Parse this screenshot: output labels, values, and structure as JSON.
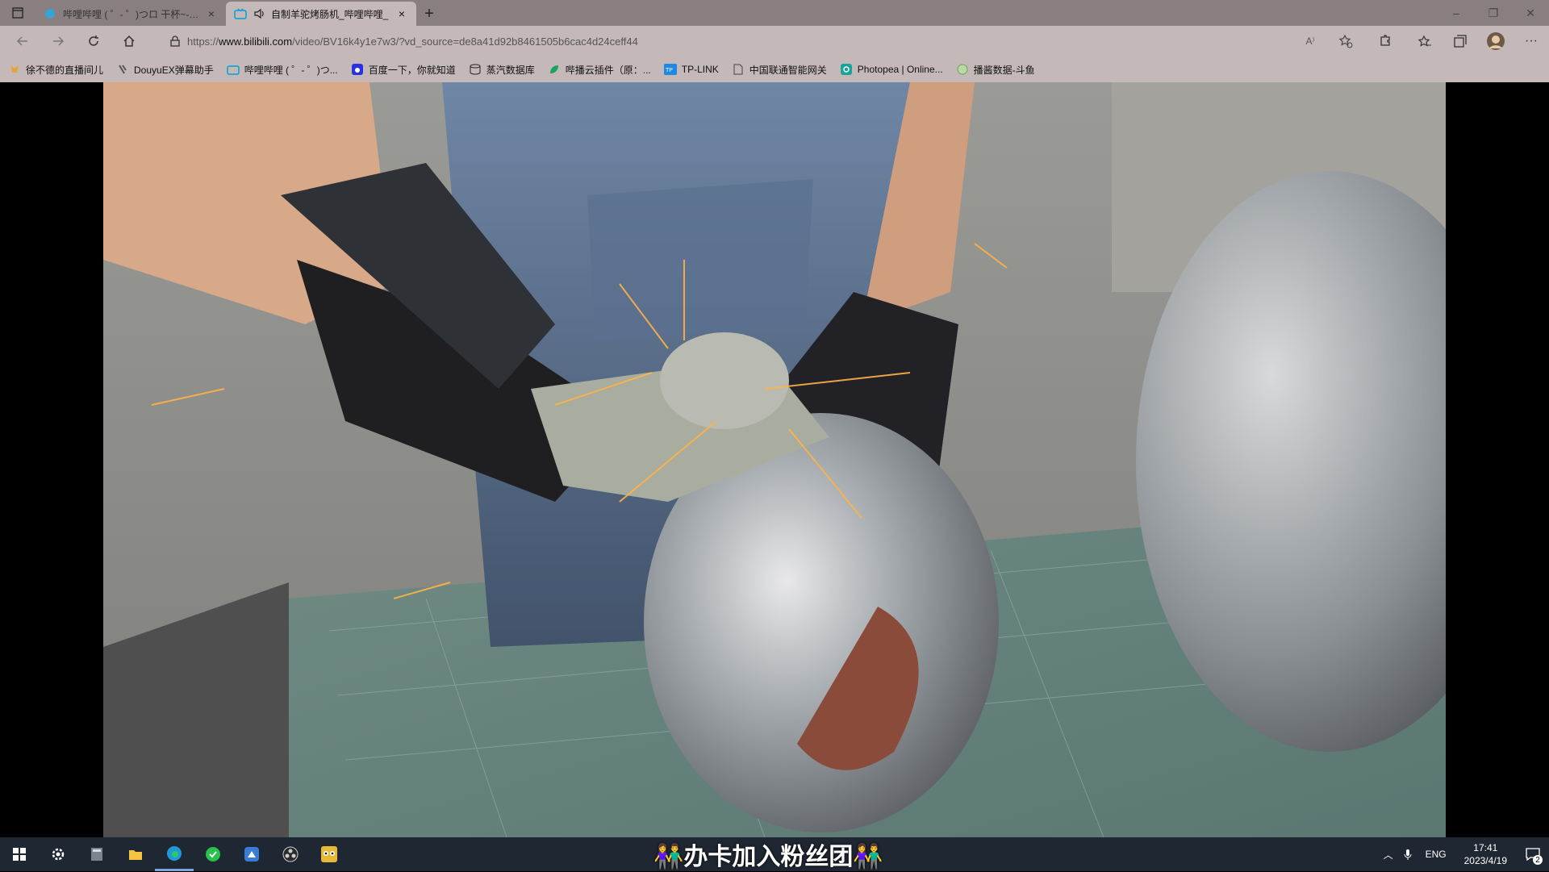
{
  "browser": {
    "tabs": [
      {
        "title": "哔哩哔哩 ( ゜- ゜)つロ 干杯~-bili",
        "active": false
      },
      {
        "title": "自制羊驼烤肠机_哔哩哔哩_",
        "active": true
      }
    ],
    "new_tab_label": "+",
    "url_prefix": "https://",
    "url_domain": "www.bilibili.com",
    "url_path": "/video/BV16k4y1e7w3/?vd_source=de8a41d92b8461505b6cac4d24ceff44",
    "read_aloud_label": "A⁾"
  },
  "bookmarks": [
    {
      "label": "徐不德的直播间儿",
      "icon": "fox-icon",
      "color": "#e6a23c"
    },
    {
      "label": "DouyuEX弹幕助手",
      "icon": "tv-icon",
      "color": "#666666"
    },
    {
      "label": "哔哩哔哩 ( ゜- ゜)つ...",
      "icon": "bilibili-icon",
      "color": "#00a1d6"
    },
    {
      "label": "百度一下，你就知道",
      "icon": "paw-icon",
      "color": "#2932e1"
    },
    {
      "label": "蒸汽数据库",
      "icon": "database-icon",
      "color": "#222222"
    },
    {
      "label": "哔播云插件（原：...",
      "icon": "leaf-icon",
      "color": "#1aa260"
    },
    {
      "label": "TP-LINK",
      "icon": "tp-link-icon",
      "color": "#1e88e5"
    },
    {
      "label": "中国联通智能网关",
      "icon": "page-icon",
      "color": "#444444"
    },
    {
      "label": "Photopea | Online...",
      "icon": "photopea-icon",
      "color": "#18a497"
    },
    {
      "label": "播酱数据-斗鱼",
      "icon": "globe-icon",
      "color": "#6aa84f"
    }
  ],
  "taskbar": {
    "apps": [
      "start-icon",
      "settings-icon",
      "calculator-icon",
      "file-explorer-icon",
      "edge-icon",
      "green-app-icon",
      "blue-app-icon",
      "obs-icon",
      "owl-app-icon"
    ],
    "banner": "👫办卡加入粉丝团👫",
    "lang": "ENG",
    "time": "17:41",
    "date": "2023/4/19",
    "notifications": "2"
  }
}
